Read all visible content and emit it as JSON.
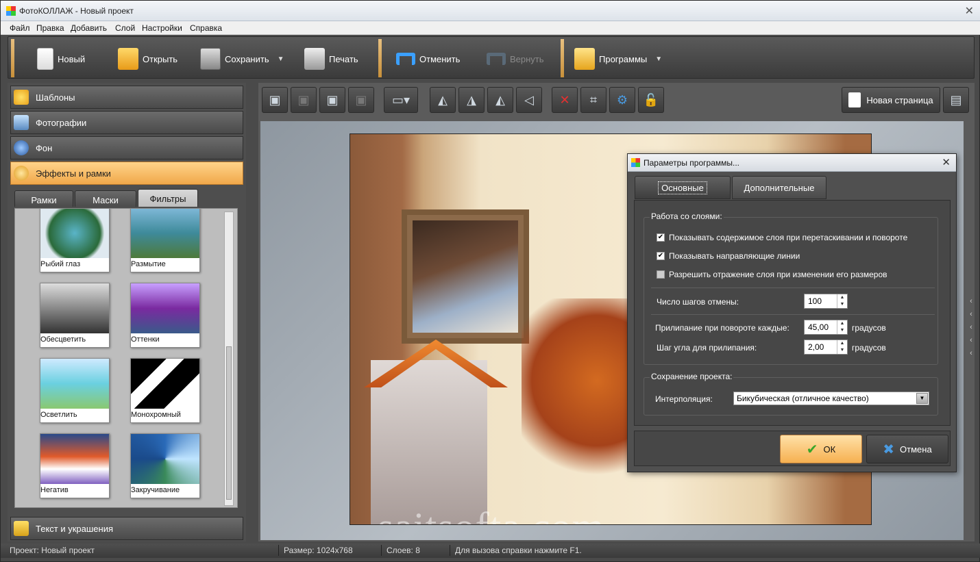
{
  "window": {
    "title": "ФотоКОЛЛАЖ - Новый проект",
    "close_glyph": "✕"
  },
  "menu": [
    "Файл",
    "Правка",
    "Добавить",
    "Слой",
    "Настройки",
    "Справка"
  ],
  "toolbar": {
    "new": "Новый",
    "open": "Открыть",
    "save": "Сохранить",
    "print": "Печать",
    "undo": "Отменить",
    "redo": "Вернуть",
    "programs": "Программы",
    "caret": "▼"
  },
  "left_panel": {
    "sections": [
      {
        "label": "Шаблоны",
        "icon": "star-icon"
      },
      {
        "label": "Фотографии",
        "icon": "photo-icon"
      },
      {
        "label": "Фон",
        "icon": "globe-icon"
      },
      {
        "label": "Эффекты и рамки",
        "icon": "palette-icon"
      },
      {
        "label": "Текст и украшения",
        "icon": "text-t-icon"
      }
    ],
    "tabs": [
      "Рамки",
      "Маски",
      "Фильтры"
    ],
    "active_tab": "Фильтры",
    "filters": [
      "Рыбий глаз",
      "Размытие",
      "Обесцветить",
      "Оттенки",
      "Осветлить",
      "Монохромный",
      "Негатив",
      "Закручивание"
    ]
  },
  "canvas_toolbar": {
    "new_page": "Новая страница"
  },
  "watermark": "saitsofta.com",
  "status": {
    "project": "Проект: Новый проект",
    "size": "Размер: 1024x768",
    "layers": "Слоев: 8",
    "help": "Для вызова справки нажмите F1."
  },
  "dialog": {
    "title": "Параметры программы...",
    "tabs": [
      "Основные",
      "Дополнительные"
    ],
    "layers_group": "Работа со слоями:",
    "checkboxes": [
      {
        "label": "Показывать содержимое слоя при перетаскивании и повороте",
        "checked": true
      },
      {
        "label": "Показывать направляющие линии",
        "checked": true
      },
      {
        "label": "Разрешить отражение слоя при изменении его размеров",
        "checked": false
      }
    ],
    "undo_steps_label": "Число шагов отмены:",
    "undo_steps_value": "100",
    "snap_rotate_label": "Прилипание при повороте каждые:",
    "snap_rotate_value": "45,00",
    "snap_step_label": "Шаг угла для прилипания:",
    "snap_step_value": "2,00",
    "degrees": "градусов",
    "save_group": "Сохранение проекта:",
    "interp_label": "Интерполяция:",
    "interp_value": "Бикубическая (отличное качество)",
    "ok": "ОК",
    "cancel": "Отмена"
  }
}
